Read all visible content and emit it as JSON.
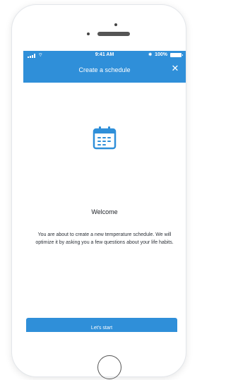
{
  "status_bar": {
    "time": "9:41 AM",
    "battery": "100%",
    "bluetooth_glyph": "✱",
    "wifi_glyph": "⌔"
  },
  "header": {
    "title": "Create a schedule",
    "close_glyph": "✕"
  },
  "content": {
    "icon": "calendar-icon",
    "heading": "Welcome",
    "description": "You are about to create a new temperature schedule. We will optimize it by asking you a few questions about your life habits."
  },
  "cta": {
    "label": "Let's start"
  },
  "colors": {
    "accent": "#2f8fd9",
    "icon": "#2f8fd9"
  }
}
